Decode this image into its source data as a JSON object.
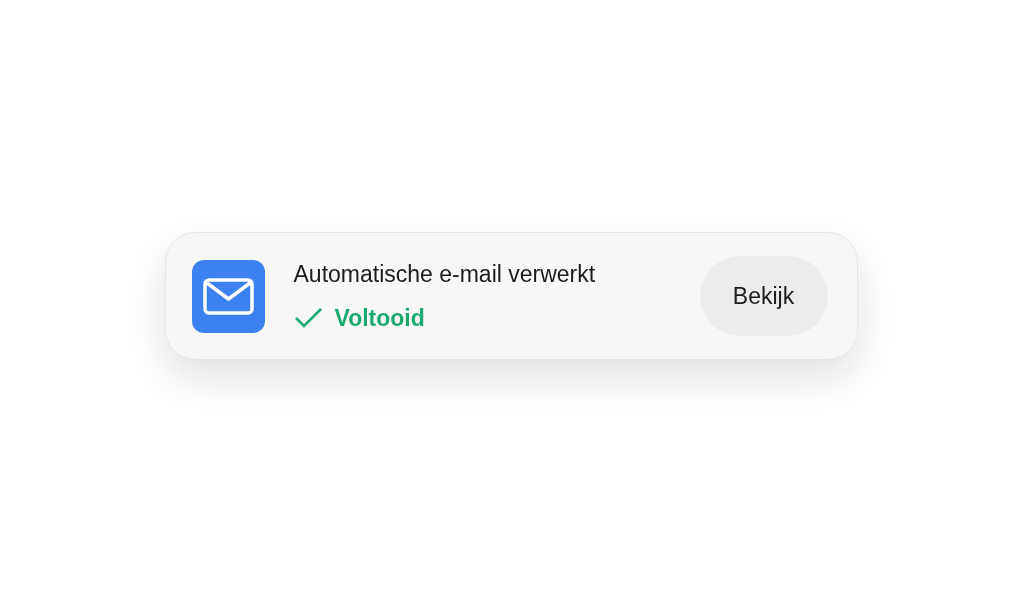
{
  "notification": {
    "title": "Automatische e-mail verwerkt",
    "status": {
      "label": "Voltooid",
      "completed": true
    },
    "button": "Bekijk"
  }
}
